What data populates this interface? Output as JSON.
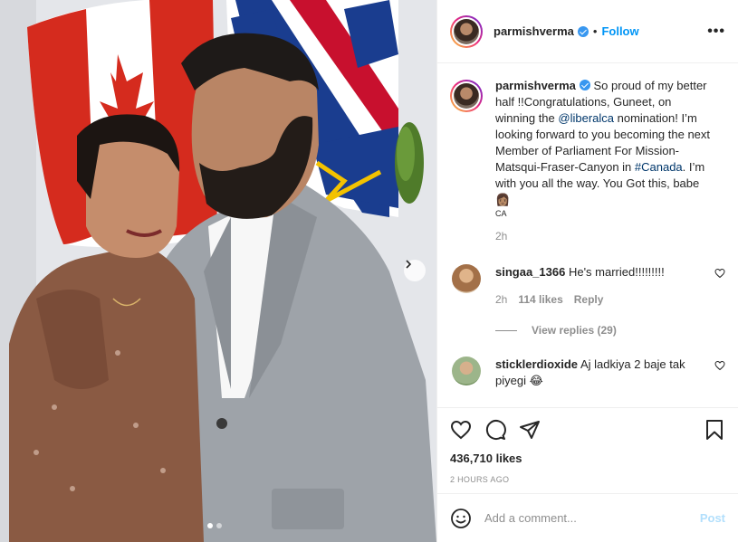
{
  "post": {
    "username": "parmishverma",
    "follow_label": "Follow",
    "more_label": "•••",
    "separator": "•"
  },
  "caption": {
    "username": "parmishverma",
    "text_1": " So proud of my better half !!Congratulations, Guneet, on winning the ",
    "mention": "@liberalca",
    "text_2": " nomination! I’m looking forward to you becoming the next Member of Parliament For Mission-Matsqui-Fraser-Canyon in ",
    "hashtag": "#Canada",
    "text_3": ". I’m with you all the way. You Got this, babe 👩🏽",
    "flag_label": "CA",
    "time": "2h"
  },
  "comments": [
    {
      "username": "singaa_1366",
      "text": " He's married!!!!!!!!!",
      "time": "2h",
      "likes": "114 likes",
      "reply_label": "Reply",
      "view_replies": "View replies (29)",
      "avatar_color": "#c9a27d"
    },
    {
      "username": "sticklerdioxide",
      "text": " Aj ladkiya 2 baje tak piyegi 😂",
      "avatar_color": "#8fb07a"
    }
  ],
  "actions": {
    "likes": "436,710 likes",
    "time": "2 HOURS AGO"
  },
  "add_comment": {
    "placeholder": "Add a comment...",
    "post_label": "Post"
  },
  "carousel": {
    "slide_count": 2,
    "active_slide": 1
  },
  "colors": {
    "accent": "#0095f6",
    "verified": "#3897f0",
    "muted": "#8e8e8e",
    "post_disabled": "#b2dffc"
  }
}
